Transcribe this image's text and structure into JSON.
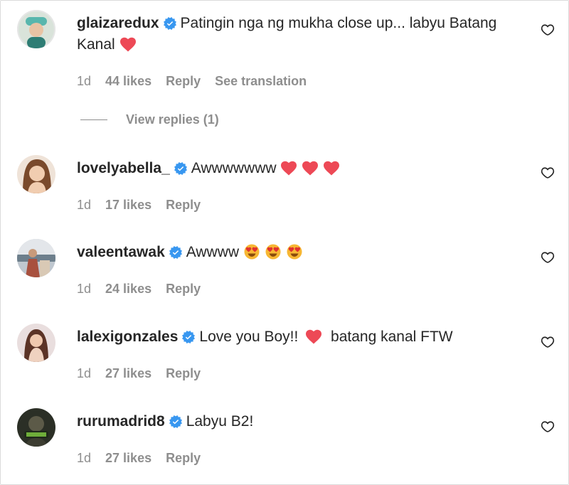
{
  "colors": {
    "heart": "#ed4956",
    "verified": "#3897f0",
    "secondary": "#8e8e8e"
  },
  "comments": [
    {
      "username": "glaizaredux",
      "text_parts": [
        "Patingin nga ng mukha close up... labyu Batang Kanal"
      ],
      "emoji_after": [
        "red-heart"
      ],
      "time": "1d",
      "likes": "44 likes",
      "reply": "Reply",
      "translation": "See translation"
    },
    {
      "username": "lovelyabella_",
      "text_parts": [
        "Awwwwwww"
      ],
      "emoji_after": [
        "red-heart",
        "red-heart",
        "red-heart"
      ],
      "time": "1d",
      "likes": "17 likes",
      "reply": "Reply"
    },
    {
      "username": "valeentawak",
      "text_parts": [
        "Awwww"
      ],
      "emoji_after": [
        "heart-eyes",
        "heart-eyes",
        "heart-eyes"
      ],
      "time": "1d",
      "likes": "24 likes",
      "reply": "Reply"
    },
    {
      "username": "lalexigonzales",
      "text_parts": [
        "Love you Boy!!",
        "batang kanal FTW"
      ],
      "emoji_after": [
        "red-heart"
      ],
      "time": "1d",
      "likes": "27 likes",
      "reply": "Reply"
    },
    {
      "username": "rurumadrid8",
      "text_parts": [
        "Labyu B2!"
      ],
      "emoji_after": [],
      "time": "1d",
      "likes": "27 likes",
      "reply": "Reply"
    }
  ],
  "view_replies": "View replies (1)"
}
